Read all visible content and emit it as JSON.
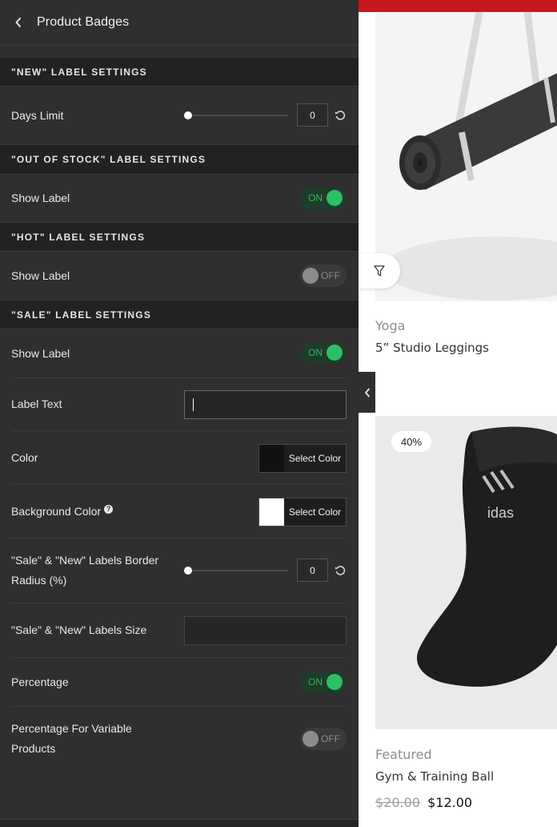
{
  "panel": {
    "title": "Product Badges",
    "back_icon": "chevron-left-icon",
    "sections": {
      "new": "\"NEW\" LABEL SETTINGS",
      "out_of_stock": "\"OUT OF STOCK\" LABEL SETTINGS",
      "hot": "\"HOT\" LABEL SETTINGS",
      "sale": "\"SALE\" LABEL SETTINGS"
    },
    "days_limit": {
      "label": "Days Limit",
      "value": "0",
      "slider_fraction": 0
    },
    "oos_show": {
      "label": "Show Label",
      "state": "ON"
    },
    "hot_show": {
      "label": "Show Label",
      "state": "OFF"
    },
    "sale_show": {
      "label": "Show Label",
      "state": "ON"
    },
    "label_text": {
      "label": "Label Text",
      "value": ""
    },
    "color": {
      "label": "Color",
      "button": "Select Color",
      "swatch": "#111111"
    },
    "bg_color": {
      "label": "Background Color",
      "button": "Select Color",
      "swatch": "#ffffff",
      "help": "?"
    },
    "border_radius": {
      "label_line1": "\"Sale\" & \"New\" Labels Border",
      "label_line2": "Radius (%)",
      "value": "0",
      "slider_fraction": 0
    },
    "labels_size": {
      "label": "\"Sale\" & \"New\" Labels Size",
      "value": ""
    },
    "percentage": {
      "label": "Percentage",
      "state": "ON"
    },
    "percentage_variable": {
      "label_line1": "Percentage For Variable",
      "label_line2": "Products",
      "state": "OFF"
    }
  },
  "preview": {
    "accent": "#c8171f",
    "products": [
      {
        "category": "Yoga",
        "title": "5” Studio Leggings"
      },
      {
        "badge": "40%",
        "category": "Featured",
        "title": "Gym & Training Ball",
        "old_price": "$20.00",
        "price": "$12.00"
      }
    ]
  }
}
